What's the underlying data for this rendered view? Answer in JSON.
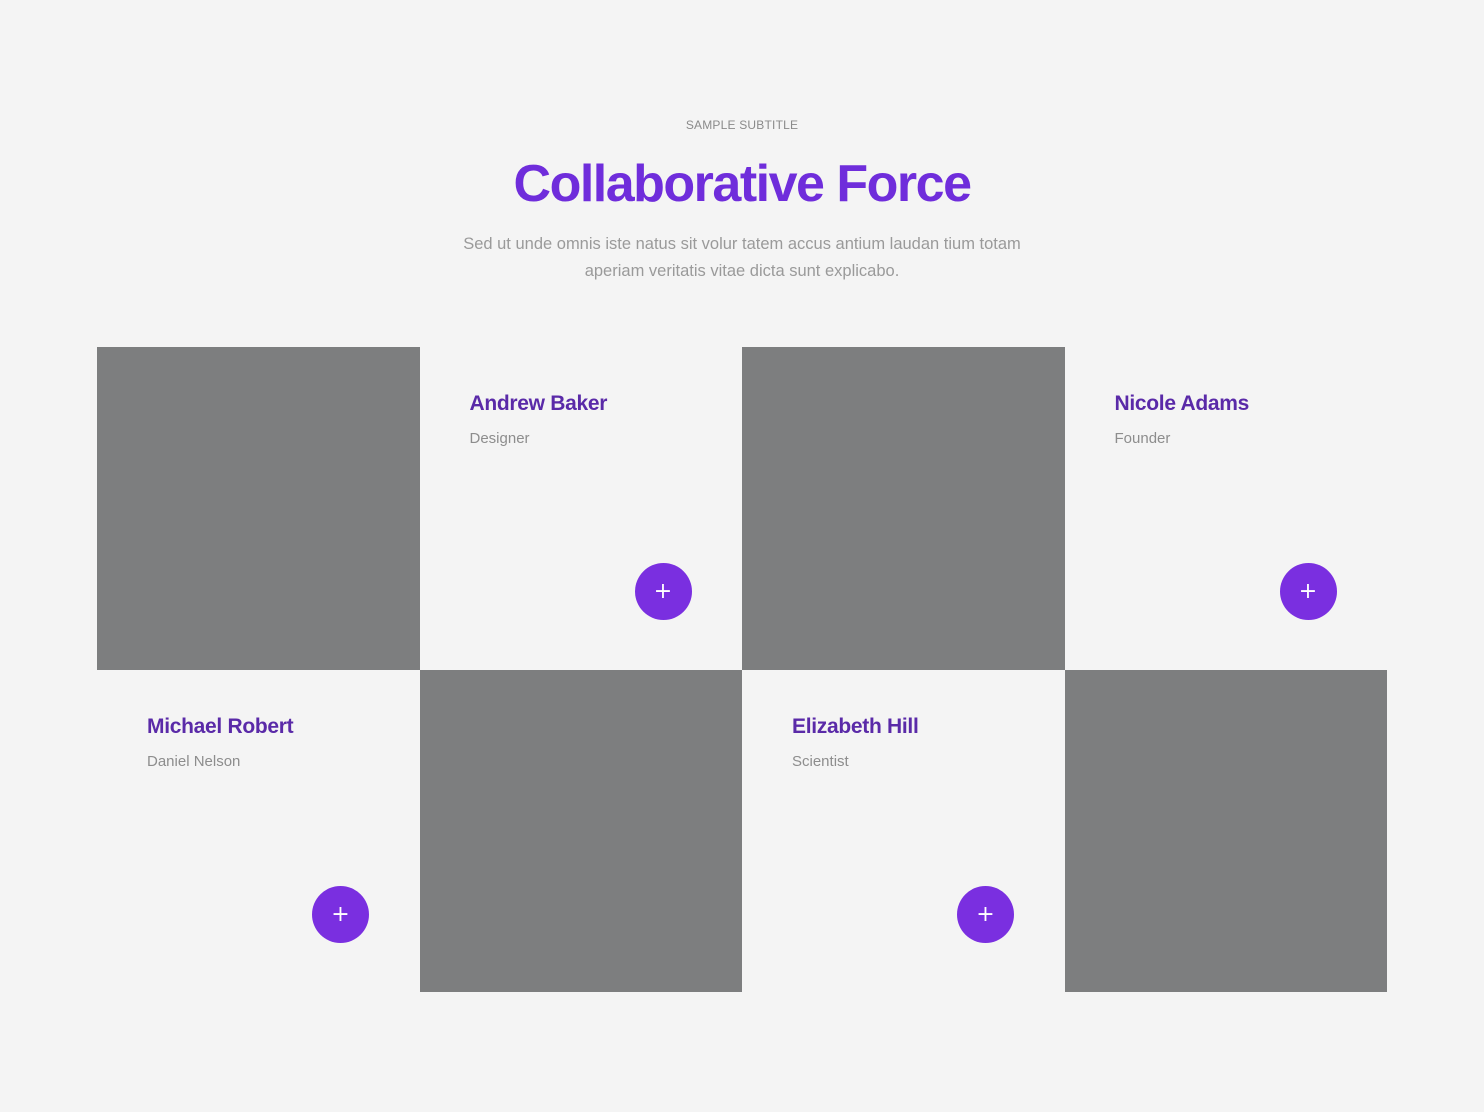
{
  "header": {
    "subtitle": "SAMPLE SUBTITLE",
    "title": "Collaborative Force",
    "description": "Sed ut unde omnis iste natus sit volur tatem accus antium laudan tium totam aperiam veritatis vitae dicta sunt explicabo."
  },
  "team": [
    {
      "name": "Andrew Baker",
      "role": "Designer",
      "button_icon": "+"
    },
    {
      "name": "Nicole Adams",
      "role": "Founder",
      "button_icon": "+"
    },
    {
      "name": "Michael Robert",
      "role": "Daniel Nelson",
      "button_icon": "+"
    },
    {
      "name": "Elizabeth Hill",
      "role": "Scientist",
      "button_icon": "+"
    }
  ],
  "colors": {
    "accent": "#7a2fe0",
    "title": "#6f2ddb",
    "name": "#5a2aa8",
    "photo_placeholder": "#7d7e7f",
    "background": "#f4f4f4"
  },
  "icons": {
    "expand": "plus-icon"
  }
}
